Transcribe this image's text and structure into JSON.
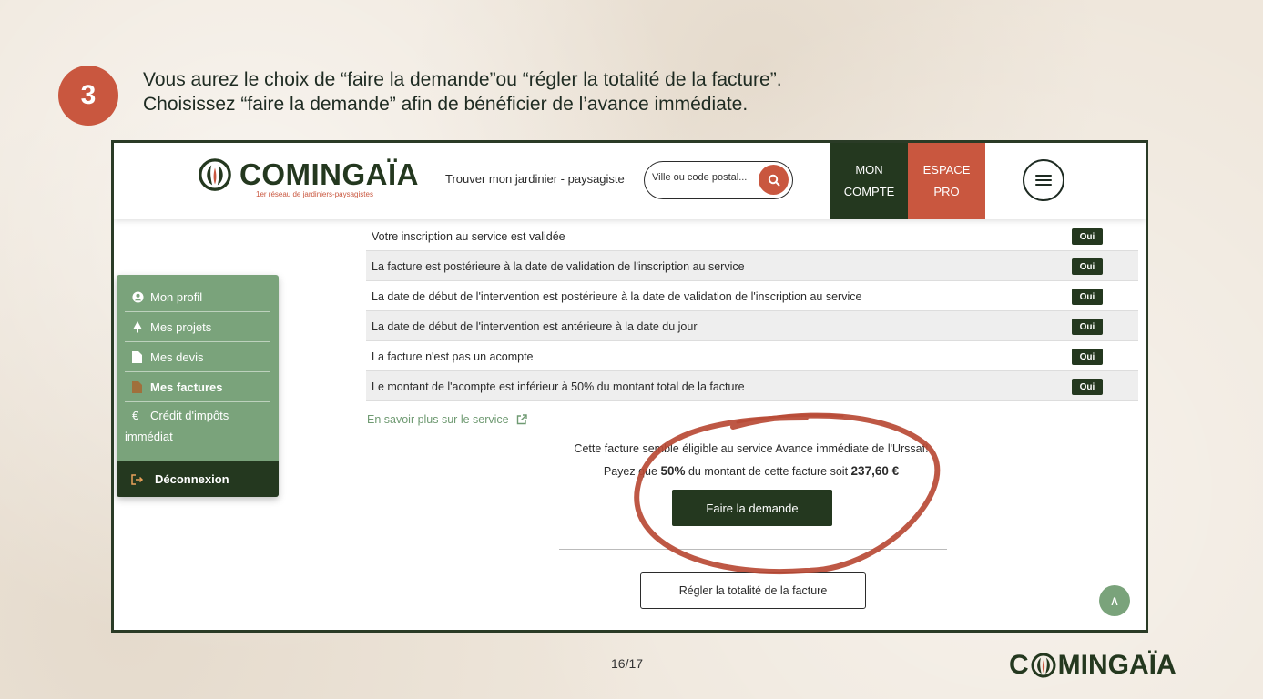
{
  "step": {
    "number": "3",
    "line1": "Vous aurez le choix de “faire la demande”ou “régler la totalité de la facture”.",
    "line2": "Choisissez “faire la demande” afin de bénéficier de l’avance immédiate."
  },
  "navbar": {
    "logo_word": "COMINGAÏA",
    "logo_tagline": "1er réseau de jardiniers-paysagistes",
    "find_link": "Trouver mon jardinier - paysagiste",
    "search_placeholder": "Ville ou code postal...",
    "account_line1": "MON",
    "account_line2": "COMPTE",
    "pro_line1": "ESPACE",
    "pro_line2": "PRO"
  },
  "sidebar": {
    "items": [
      {
        "label": "Mon profil",
        "icon": "user-icon"
      },
      {
        "label": "Mes projets",
        "icon": "tree-icon"
      },
      {
        "label": "Mes devis",
        "icon": "file-icon"
      },
      {
        "label": "Mes factures",
        "icon": "invoice-icon",
        "active": true
      }
    ],
    "credit_symbol": "€",
    "credit_label": "Crédit d'impôts immédiat",
    "logout_label": "Déconnexion"
  },
  "criteria": {
    "rows": [
      {
        "text": "Votre inscription au service est validée",
        "status": "Oui"
      },
      {
        "text": "La facture est postérieure à la date de validation de l'inscription au service",
        "status": "Oui"
      },
      {
        "text": "La date de début de l'intervention est postérieure à la date de validation de l'inscription au service",
        "status": "Oui"
      },
      {
        "text": "La date de début de l'intervention est antérieure à la date du jour",
        "status": "Oui"
      },
      {
        "text": "La facture n'est pas un acompte",
        "status": "Oui"
      },
      {
        "text": "Le montant de l'acompte est inférieur à 50% du montant total de la facture",
        "status": "Oui"
      }
    ]
  },
  "main": {
    "learn_more": "En savoir plus sur le service",
    "eligible_text": "Cette facture semble éligible au service Avance immédiate de l'Urssaf!",
    "pay_prefix": "Payez que",
    "pay_percent": "50%",
    "pay_middle": "du montant de cette facture soit",
    "pay_amount": "237,60 €",
    "ask_button": "Faire la demande",
    "pay_all_button": "Régler la totalité de la facture",
    "back_to_top": "∧"
  },
  "footer": {
    "page_number": "16/17",
    "logo_left": "C",
    "logo_right": "MINGAÏA"
  },
  "colors": {
    "dark_green": "#24381f",
    "terracotta": "#c9573f",
    "sage": "#7aa37b"
  }
}
